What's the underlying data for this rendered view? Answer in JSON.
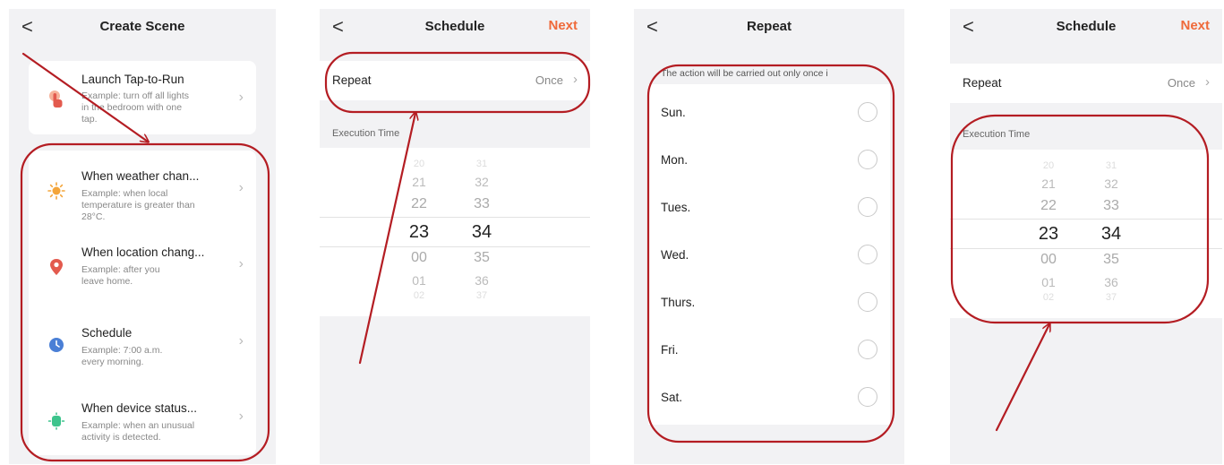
{
  "screens": [
    {
      "back": "<",
      "title": "Create Scene",
      "launch": {
        "title": "Launch Tap-to-Run",
        "desc": [
          "Example: turn off all lights",
          "in the bedroom with one",
          "tap."
        ],
        "icon": "hand-tap-icon"
      },
      "conditions": [
        {
          "title": "When weather chan...",
          "desc": [
            "Example: when local",
            "temperature is greater than",
            "28°C."
          ],
          "icon": "sun-icon"
        },
        {
          "title": "When location chang...",
          "desc": [
            "Example: after you",
            "leave home."
          ],
          "icon": "location-pin-icon"
        },
        {
          "title": "Schedule",
          "desc": [
            "Example: 7:00 a.m.",
            "every morning."
          ],
          "icon": "clock-icon"
        },
        {
          "title": "When device status...",
          "desc": [
            "Example: when an unusual",
            "activity is detected."
          ],
          "icon": "device-icon"
        }
      ]
    },
    {
      "back": "<",
      "title": "Schedule",
      "next": "Next",
      "repeat_label": "Repeat",
      "repeat_value": "Once",
      "exec_label": "Execution Time",
      "hours": [
        "20",
        "21",
        "22",
        "23",
        "00",
        "01",
        "02"
      ],
      "minutes": [
        "31",
        "32",
        "33",
        "34",
        "35",
        "36",
        "37"
      ]
    },
    {
      "back": "<",
      "title": "Repeat",
      "note": "The action will be carried out only once i",
      "days": [
        "Sun.",
        "Mon.",
        "Tues.",
        "Wed.",
        "Thurs.",
        "Fri.",
        "Sat."
      ]
    },
    {
      "back": "<",
      "title": "Schedule",
      "next": "Next",
      "repeat_label": "Repeat",
      "repeat_value": "Once",
      "exec_label": "Execution Time",
      "hours": [
        "20",
        "21",
        "22",
        "23",
        "00",
        "01",
        "02"
      ],
      "minutes": [
        "31",
        "32",
        "33",
        "34",
        "35",
        "36",
        "37"
      ]
    }
  ],
  "colors": {
    "accent": "#ef6a3a",
    "annotation": "#b41d23",
    "sun": "#f4a53a",
    "pin": "#e35a4e",
    "clock": "#4a7fd6",
    "device": "#3cc48c"
  }
}
